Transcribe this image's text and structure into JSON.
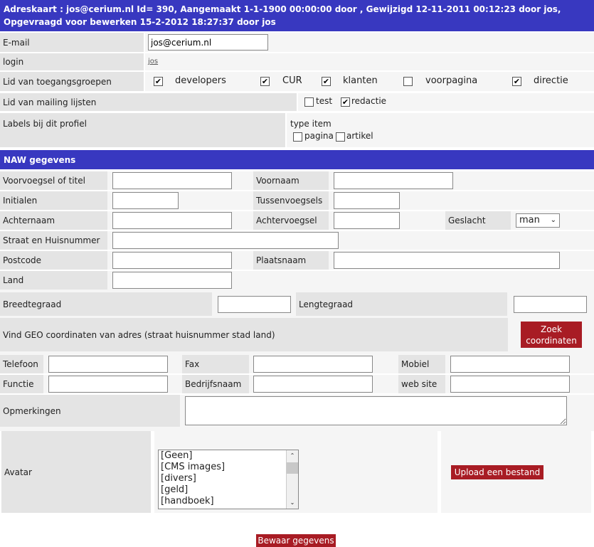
{
  "header": {
    "title": "Adreskaart : jos@cerium.nl  Id= 390, Aangemaakt 1-1-1900 00:00:00 door , Gewijzigd 12-11-2011 00:12:23 door jos, Opgevraagd voor bewerken 15-2-2012 18:27:37 door jos"
  },
  "account": {
    "email_label": "E-mail",
    "email_value": "jos@cerium.nl",
    "login_label": "login",
    "login_value": "jos",
    "groups_label": "Lid van toegangsgroepen",
    "groups": [
      {
        "label": "developers",
        "checked": true
      },
      {
        "label": "CUR",
        "checked": true
      },
      {
        "label": "klanten",
        "checked": true
      },
      {
        "label": "voorpagina",
        "checked": false
      },
      {
        "label": "directie",
        "checked": true
      }
    ],
    "mailing_label": "Lid van mailing lijsten",
    "mailing": [
      {
        "label": "test",
        "checked": false
      },
      {
        "label": "redactie",
        "checked": true
      }
    ],
    "labels_label": "Labels bij dit profiel",
    "type_item": "type item",
    "type_items": [
      {
        "label": "pagina",
        "checked": false
      },
      {
        "label": "artikel",
        "checked": false
      }
    ]
  },
  "naw": {
    "title": "NAW gegevens",
    "voorvoegsel": "Voorvoegsel of titel",
    "voornaam": "Voornaam",
    "initialen": "Initialen",
    "tussenvoegsels": "Tussenvoegsels",
    "achternaam": "Achternaam",
    "achtervoegsel": "Achtervoegsel",
    "geslacht": "Geslacht",
    "geslacht_value": "man",
    "straat": "Straat en Huisnummer",
    "postcode": "Postcode",
    "plaatsnaam": "Plaatsnaam",
    "land": "Land",
    "breedtegraad": "Breedtegraad",
    "lengtegraad": "Lengtegraad",
    "geo_text": "Vind GEO coordinaten van adres (straat huisnummer stad land)",
    "geo_button": "Zoek coordinaten",
    "telefoon": "Telefoon",
    "fax": "Fax",
    "mobiel": "Mobiel",
    "functie": "Functie",
    "bedrijfsnaam": "Bedrijfsnaam",
    "website": "web site",
    "opmerkingen": "Opmerkingen",
    "avatar": "Avatar",
    "avatar_options": [
      "[Geen]",
      "[CMS images]",
      "[divers]",
      "[geld]",
      "[handboek]"
    ],
    "upload_button": "Upload een bestand"
  },
  "save_button": "Bewaar gegevens",
  "colors": {
    "header": "#3838c0",
    "button": "#a81c24"
  }
}
